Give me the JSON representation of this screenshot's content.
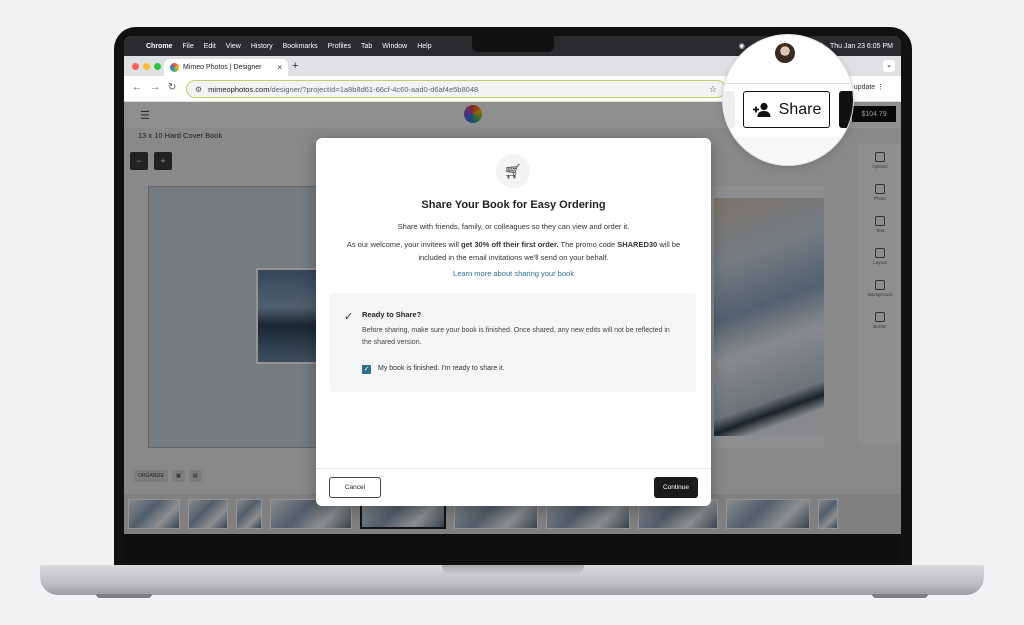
{
  "menubar": {
    "apple": "",
    "items": [
      "Chrome",
      "File",
      "Edit",
      "View",
      "History",
      "Bookmarks",
      "Profiles",
      "Tab",
      "Window",
      "Help"
    ],
    "datetime": "Thu Jan 23  6:05 PM"
  },
  "browser": {
    "tab_title": "Mimeo Photos | Designer",
    "tab_close": "×",
    "new_tab": "+",
    "url_host": "mimeophotos.com",
    "url_path": "/designer/?projectId=1a8b8d61-66cf-4c60-aad0-d6af4e5b8048",
    "update_label": "to update",
    "colors": {
      "close": "#ff5f57",
      "minimize": "#febc2e",
      "maximize": "#28c840"
    }
  },
  "app": {
    "book_title": "13 x 10 Hard Cover Book",
    "price": "$104.79",
    "organize_label": "ORGANIZE",
    "right_panel": [
      "Options",
      "Photo",
      "Text",
      "Layout",
      "Background",
      "Border"
    ]
  },
  "modal": {
    "title": "Share Your Book for Easy Ordering",
    "subtitle": "Share with friends, family, or colleagues so they can view and order it.",
    "promo_part1": "As our welcome, your invitees will ",
    "promo_bold1": "get 30% off their first order.",
    "promo_part2": " The promo code ",
    "promo_bold2": "SHARED30",
    "promo_part3": " will be included in the email invitations we'll send on your behalf.",
    "learn_more": "Learn more about sharing your book",
    "ready_title": "Ready to Share?",
    "ready_text": "Before sharing, make sure your book is finished. Once shared, any new edits will not be reflected in the shared version.",
    "checkbox_label": "My book is finished. I'm ready to share it.",
    "checkbox_checked": true,
    "cancel_label": "Cancel",
    "continue_label": "Continue",
    "accent": "#2f6f86"
  },
  "magnifier": {
    "share_label": "Share"
  }
}
